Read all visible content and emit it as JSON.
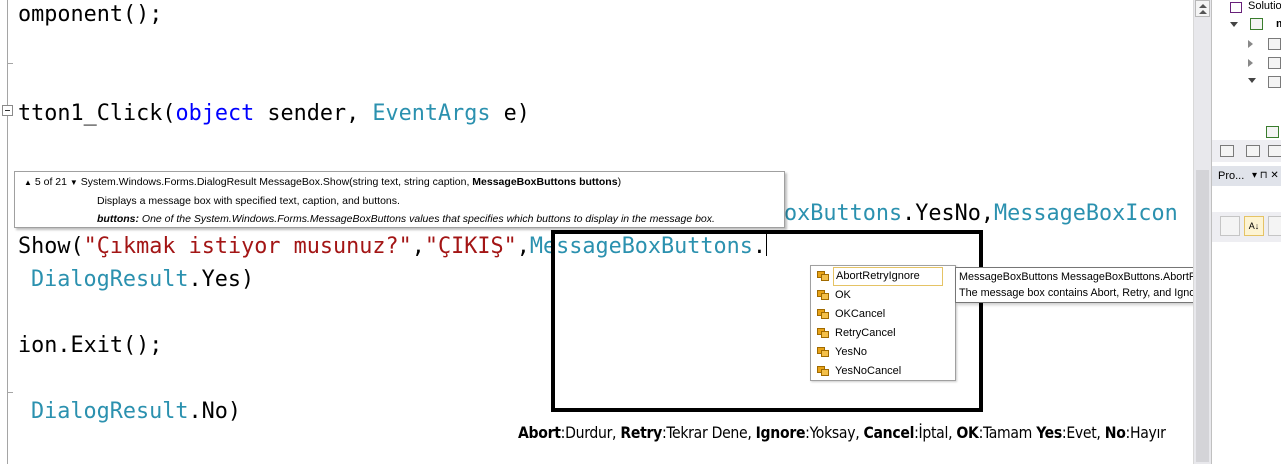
{
  "code": {
    "line1": "omponent();",
    "line2_a": "tton1_Click(",
    "line2_kw": "object",
    "line2_b": " sender, ",
    "line2_type": "EventArgs",
    "line2_c": " e)",
    "line3_type": "oxButtons",
    "line3_a": ".YesNo,",
    "line3_type2": "MessageBoxIcon",
    "line4_a": "Show(",
    "line4_str1": "\"Çıkmak istiyor musunuz?\"",
    "line4_b": ",",
    "line4_str2": "\"ÇIKIŞ\"",
    "line4_c": ",",
    "line4_type": "MessageBoxButtons",
    "line4_d": ".",
    "line5_type": "DialogResult",
    "line5_a": ".Yes)",
    "line6_a": "ion.Exit();",
    "line7_type": "DialogResult",
    "line7_a": ".No)"
  },
  "signature_tip": {
    "counter": "5 of 21",
    "signature_pre": "System.Windows.Forms.DialogResult MessageBox.Show(string text, string caption, ",
    "signature_bold": "MessageBoxButtons buttons",
    "signature_post": ")",
    "description": "Displays a message box with specified text, caption, and buttons.",
    "param_name": "buttons:",
    "param_desc": " One of the System.Windows.Forms.MessageBoxButtons values that specifies which buttons to display in the message box."
  },
  "completion": {
    "items": [
      "AbortRetryIgnore",
      "OK",
      "OKCancel",
      "RetryCancel",
      "YesNo",
      "YesNoCancel"
    ],
    "selected": "AbortRetryIgnore"
  },
  "completion_tip": {
    "line1": "MessageBoxButtons MessageBoxButtons.AbortRetryIgnore",
    "line2": "The message box contains Abort, Retry, and Ignore buttons."
  },
  "caption": {
    "abort_k": "Abort",
    "abort_v": ":Durdur, ",
    "retry_k": "Retry",
    "retry_v": ":Tekrar Dene, ",
    "ignore_k": "Ignore",
    "ignore_v": ":Yoksay, ",
    "cancel_k": "Cancel",
    "cancel_v": ":İptal, ",
    "ok_k": "OK",
    "ok_v": ":Tamam ",
    "yes_k": "Yes",
    "yes_v": ":Evet, ",
    "no_k": "No",
    "no_v": ":Hayır"
  },
  "solution_explorer": {
    "title": "Solutio",
    "project": "m"
  },
  "properties": {
    "title": "Pro...",
    "pin": "▾ ⊓ ✕"
  },
  "colors": {
    "keyword": "#0000ff",
    "type": "#2b91af",
    "string": "#a31515",
    "highlight_border": "#000000"
  },
  "icons": {
    "enum_member": "enum-member-icon",
    "collapse": "collapse-minus-icon"
  }
}
